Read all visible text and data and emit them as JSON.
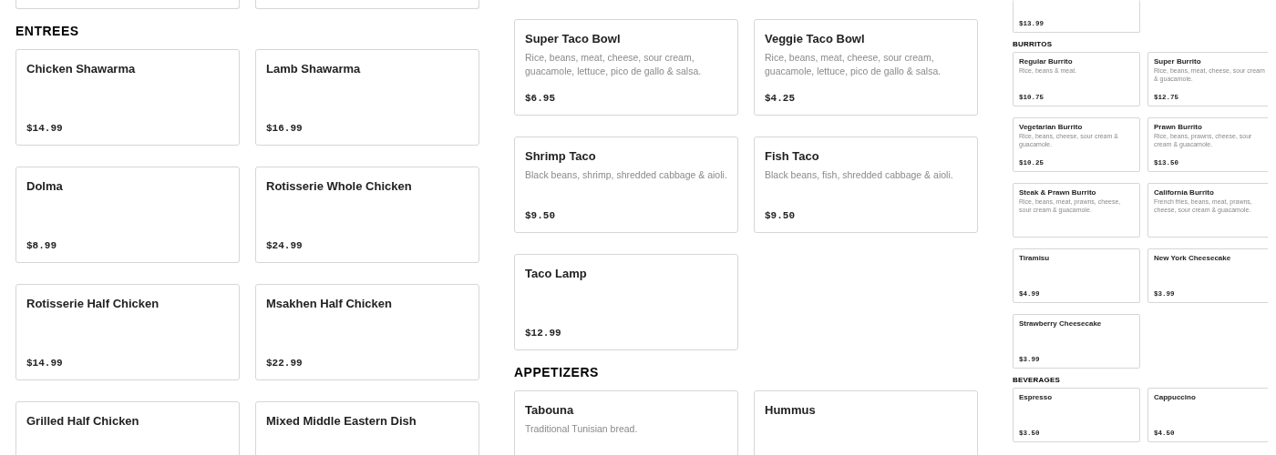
{
  "panels": [
    {
      "sections": [
        {
          "items": [
            {
              "kind": "stub"
            },
            {
              "kind": "stub"
            }
          ]
        },
        {
          "heading": "ENTREES",
          "items": [
            {
              "kind": "card",
              "name": "Chicken Shawarma",
              "price": "$14.99"
            },
            {
              "kind": "card",
              "name": "Lamb Shawarma",
              "price": "$16.99"
            },
            {
              "kind": "card",
              "name": "Dolma",
              "price": "$8.99"
            },
            {
              "kind": "card",
              "name": "Rotisserie Whole Chicken",
              "price": "$24.99"
            },
            {
              "kind": "card",
              "name": "Rotisserie Half Chicken",
              "price": "$14.99"
            },
            {
              "kind": "card",
              "name": "Msakhen Half Chicken",
              "price": "$22.99"
            },
            {
              "kind": "card",
              "name": "Grilled Half Chicken"
            },
            {
              "kind": "card",
              "name": "Mixed Middle Eastern Dish"
            }
          ]
        }
      ]
    },
    {
      "sections": [
        {
          "items": [
            {
              "kind": "card",
              "name": "Super Taco Bowl",
              "description": "Rice, beans, meat, cheese, sour cream, guacamole, lettuce, pico de gallo & salsa.",
              "price": "$6.95"
            },
            {
              "kind": "card",
              "name": "Veggie Taco Bowl",
              "description": "Rice, beans, meat, cheese, sour cream, guacamole, lettuce, pico de gallo & salsa.",
              "price": "$4.25"
            },
            {
              "kind": "card",
              "name": "Shrimp Taco",
              "description": "Black beans, shrimp, shredded cabbage & aioli.",
              "price": "$9.50"
            },
            {
              "kind": "card",
              "name": "Fish Taco",
              "description": "Black beans, fish, shredded cabbage & aioli.",
              "price": "$9.50"
            },
            {
              "kind": "card",
              "name": "Taco Lamp",
              "price": "$12.99"
            }
          ]
        },
        {
          "heading": "APPETIZERS",
          "items": [
            {
              "kind": "card",
              "name": "Tabouna",
              "description": "Traditional Tunisian bread."
            },
            {
              "kind": "card",
              "name": "Hummus"
            }
          ]
        }
      ]
    },
    {
      "sections": [
        {
          "items": [
            {
              "kind": "stub",
              "price": "$13.99"
            }
          ]
        },
        {
          "heading": "BURRITOS",
          "items": [
            {
              "kind": "card",
              "name": "Regular Burrito",
              "description": "Rice, beans & meat.",
              "price": "$10.75"
            },
            {
              "kind": "card",
              "name": "Super Burrito",
              "description": "Rice, beans, meat, cheese, sour cream & guacamole.",
              "price": "$12.75"
            },
            {
              "kind": "card",
              "name": "Vegetarian Burrito",
              "description": "Rice, beans, cheese, sour cream & guacamole.",
              "price": "$10.25"
            },
            {
              "kind": "card",
              "name": "Prawn Burrito",
              "description": "Rice, beans, prawns, cheese, sour cream & guacamole.",
              "price": "$13.50"
            },
            {
              "kind": "card",
              "name": "Steak & Prawn Burrito",
              "description": "Rice, beans, meat, prawns, cheese, sour cream & guacamole."
            },
            {
              "kind": "card",
              "name": "California Burrito",
              "description": "French fries, beans, meat, prawns, cheese, sour cream & guacamole."
            }
          ]
        },
        {
          "items": [
            {
              "kind": "card",
              "name": "Tiramisu",
              "price": "$4.99"
            },
            {
              "kind": "card",
              "name": "New York Cheesecake",
              "price": "$3.99"
            },
            {
              "kind": "card",
              "name": "Strawberry Cheesecake",
              "price": "$3.99"
            }
          ]
        },
        {
          "heading": "BEVERAGES",
          "items": [
            {
              "kind": "card",
              "name": "Espresso",
              "price": "$3.50"
            },
            {
              "kind": "card",
              "name": "Cappuccino",
              "price": "$4.50"
            }
          ]
        }
      ]
    }
  ]
}
